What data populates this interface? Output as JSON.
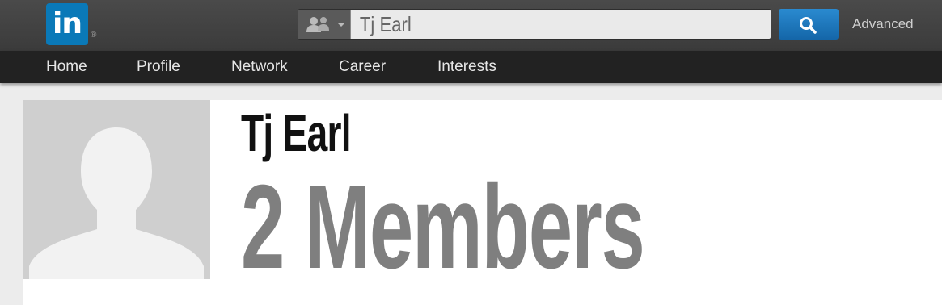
{
  "header": {
    "logo_text": "in",
    "logo_mark": "®",
    "search": {
      "type_icon": "people-icon",
      "value": "Tj Earl",
      "button_icon": "search-icon"
    },
    "advanced_label": "Advanced"
  },
  "nav": {
    "items": [
      {
        "label": "Home"
      },
      {
        "label": "Profile"
      },
      {
        "label": "Network"
      },
      {
        "label": "Career"
      },
      {
        "label": "Interests"
      }
    ]
  },
  "profile": {
    "name": "Tj Earl",
    "members_text": "2 Members",
    "avatar_icon": "default-avatar-icon"
  },
  "colors": {
    "brand": "#0a79b8",
    "search_button": "#1a74bd",
    "members_text": "#7f7f7f"
  }
}
